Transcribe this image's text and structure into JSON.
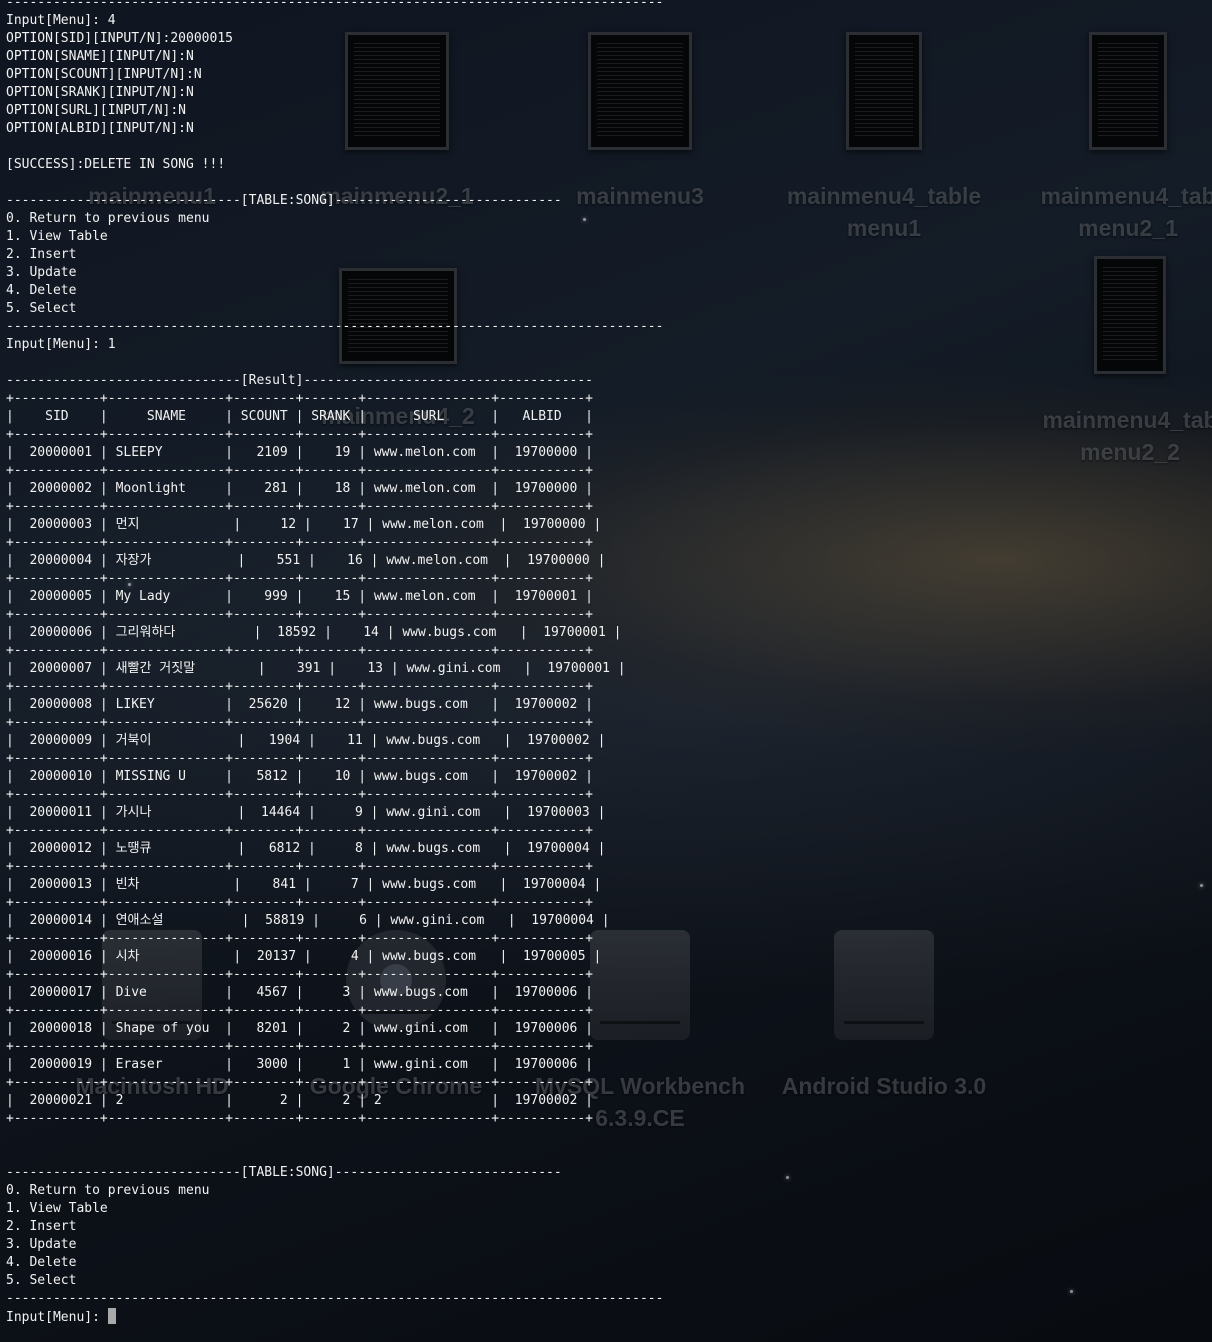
{
  "desktop": {
    "icons": [
      {
        "label": "mainmenu1"
      },
      {
        "label": "mainmenu2_1"
      },
      {
        "label": "mainmenu3"
      },
      {
        "label": "mainmenu4_table\nmenu1"
      },
      {
        "label": "mainmenu4_tab\nmenu2_1"
      },
      {
        "label": "mainmenu4_2"
      },
      {
        "label": "mainmenu4_tab\nmenu2_2"
      },
      {
        "label": "Macintosh HD"
      },
      {
        "label": "Google Chrome"
      },
      {
        "label": "MySQL Workbench\n6.3.9.CE"
      },
      {
        "label": "Android Studio 3.0"
      }
    ]
  },
  "terminal": {
    "lines": [
      "------------------------------------------------------------------------------------",
      "Input[Menu]: 4",
      "OPTION[SID][INPUT/N]:20000015",
      "OPTION[SNAME][INPUT/N]:N",
      "OPTION[SCOUNT][INPUT/N]:N",
      "OPTION[SRANK][INPUT/N]:N",
      "OPTION[SURL][INPUT/N]:N",
      "OPTION[ALBID][INPUT/N]:N",
      "",
      "[SUCCESS]:DELETE IN SONG !!!",
      "",
      "------------------------------[TABLE:SONG]-----------------------------",
      "0. Return to previous menu",
      "1. View Table",
      "2. Insert",
      "3. Update",
      "4. Delete",
      "5. Select",
      "------------------------------------------------------------------------------------",
      "Input[Menu]: 1",
      "",
      "------------------------------[Result]-------------------------------------",
      "+-----------+---------------+--------+-------+----------------+-----------+",
      "|    SID    |     SNAME     | SCOUNT | SRANK |      SURL      |   ALBID   |",
      "+-----------+---------------+--------+-------+----------------+-----------+",
      "|  20000001 | SLEEPY        |   2109 |    19 | www.melon.com  |  19700000 |",
      "+-----------+---------------+--------+-------+----------------+-----------+",
      "|  20000002 | Moonlight     |    281 |    18 | www.melon.com  |  19700000 |",
      "+-----------+---------------+--------+-------+----------------+-----------+",
      "|  20000003 | 먼지            |     12 |    17 | www.melon.com  |  19700000 |",
      "+-----------+---------------+--------+-------+----------------+-----------+",
      "|  20000004 | 자장가           |    551 |    16 | www.melon.com  |  19700000 |",
      "+-----------+---------------+--------+-------+----------------+-----------+",
      "|  20000005 | My Lady       |    999 |    15 | www.melon.com  |  19700001 |",
      "+-----------+---------------+--------+-------+----------------+-----------+",
      "|  20000006 | 그리워하다          |  18592 |    14 | www.bugs.com   |  19700001 |",
      "+-----------+---------------+--------+-------+----------------+-----------+",
      "|  20000007 | 새빨간 거짓말        |    391 |    13 | www.gini.com   |  19700001 |",
      "+-----------+---------------+--------+-------+----------------+-----------+",
      "|  20000008 | LIKEY         |  25620 |    12 | www.bugs.com   |  19700002 |",
      "+-----------+---------------+--------+-------+----------------+-----------+",
      "|  20000009 | 거북이           |   1904 |    11 | www.bugs.com   |  19700002 |",
      "+-----------+---------------+--------+-------+----------------+-----------+",
      "|  20000010 | MISSING U     |   5812 |    10 | www.bugs.com   |  19700002 |",
      "+-----------+---------------+--------+-------+----------------+-----------+",
      "|  20000011 | 가시나           |  14464 |     9 | www.gini.com   |  19700003 |",
      "+-----------+---------------+--------+-------+----------------+-----------+",
      "|  20000012 | 노땡큐           |   6812 |     8 | www.bugs.com   |  19700004 |",
      "+-----------+---------------+--------+-------+----------------+-----------+",
      "|  20000013 | 빈차            |    841 |     7 | www.bugs.com   |  19700004 |",
      "+-----------+---------------+--------+-------+----------------+-----------+",
      "|  20000014 | 연애소설          |  58819 |     6 | www.gini.com   |  19700004 |",
      "+-----------+---------------+--------+-------+----------------+-----------+",
      "|  20000016 | 시차            |  20137 |     4 | www.bugs.com   |  19700005 |",
      "+-----------+---------------+--------+-------+----------------+-----------+",
      "|  20000017 | Dive          |   4567 |     3 | www.bugs.com   |  19700006 |",
      "+-----------+---------------+--------+-------+----------------+-----------+",
      "|  20000018 | Shape of you  |   8201 |     2 | www.gini.com   |  19700006 |",
      "+-----------+---------------+--------+-------+----------------+-----------+",
      "|  20000019 | Eraser        |   3000 |     1 | www.gini.com   |  19700006 |",
      "+-----------+---------------+--------+-------+----------------+-----------+",
      "|  20000021 | 2             |      2 |     2 | 2              |  19700002 |",
      "+-----------+---------------+--------+-------+----------------+-----------+",
      "",
      "",
      "------------------------------[TABLE:SONG]-----------------------------",
      "0. Return to previous menu",
      "1. View Table",
      "2. Insert",
      "3. Update",
      "4. Delete",
      "5. Select",
      "------------------------------------------------------------------------------------"
    ],
    "prompt": "Input[Menu]: "
  }
}
